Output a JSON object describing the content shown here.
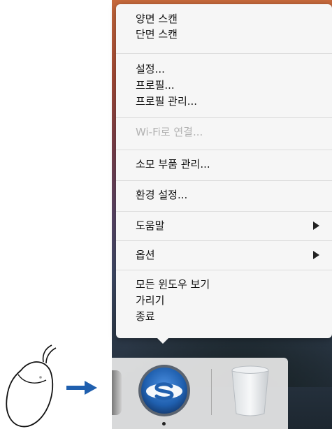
{
  "menu": {
    "groups": [
      {
        "items": [
          {
            "label": "양면 스캔"
          },
          {
            "label": "단면 스캔"
          }
        ]
      },
      {
        "items": [
          {
            "label": "설정..."
          },
          {
            "label": "프로필..."
          },
          {
            "label": "프로필 관리..."
          }
        ]
      },
      {
        "items": [
          {
            "label": "Wi-Fi로 연결...",
            "disabled": true
          }
        ]
      },
      {
        "items": [
          {
            "label": "소모 부품 관리..."
          }
        ]
      },
      {
        "items": [
          {
            "label": "환경 설정..."
          }
        ]
      },
      {
        "items": [
          {
            "label": "도움말",
            "submenu": true
          }
        ]
      },
      {
        "items": [
          {
            "label": "옵션",
            "submenu": true
          }
        ]
      },
      {
        "items": [
          {
            "label": "모든 윈도우 보기"
          },
          {
            "label": "가리기"
          },
          {
            "label": "종료"
          }
        ]
      }
    ]
  },
  "dock": {
    "items": [
      {
        "name": "scansnap-manager",
        "icon": "scansnap-icon",
        "running": true
      },
      {
        "name": "trash",
        "icon": "trash-icon"
      }
    ]
  },
  "colors": {
    "menu_bg": "#f6f6f6",
    "disabled_text": "#b3b3b3",
    "arrow_blue": "#1f5fae",
    "scansnap_blue": "#2a6fc0"
  }
}
